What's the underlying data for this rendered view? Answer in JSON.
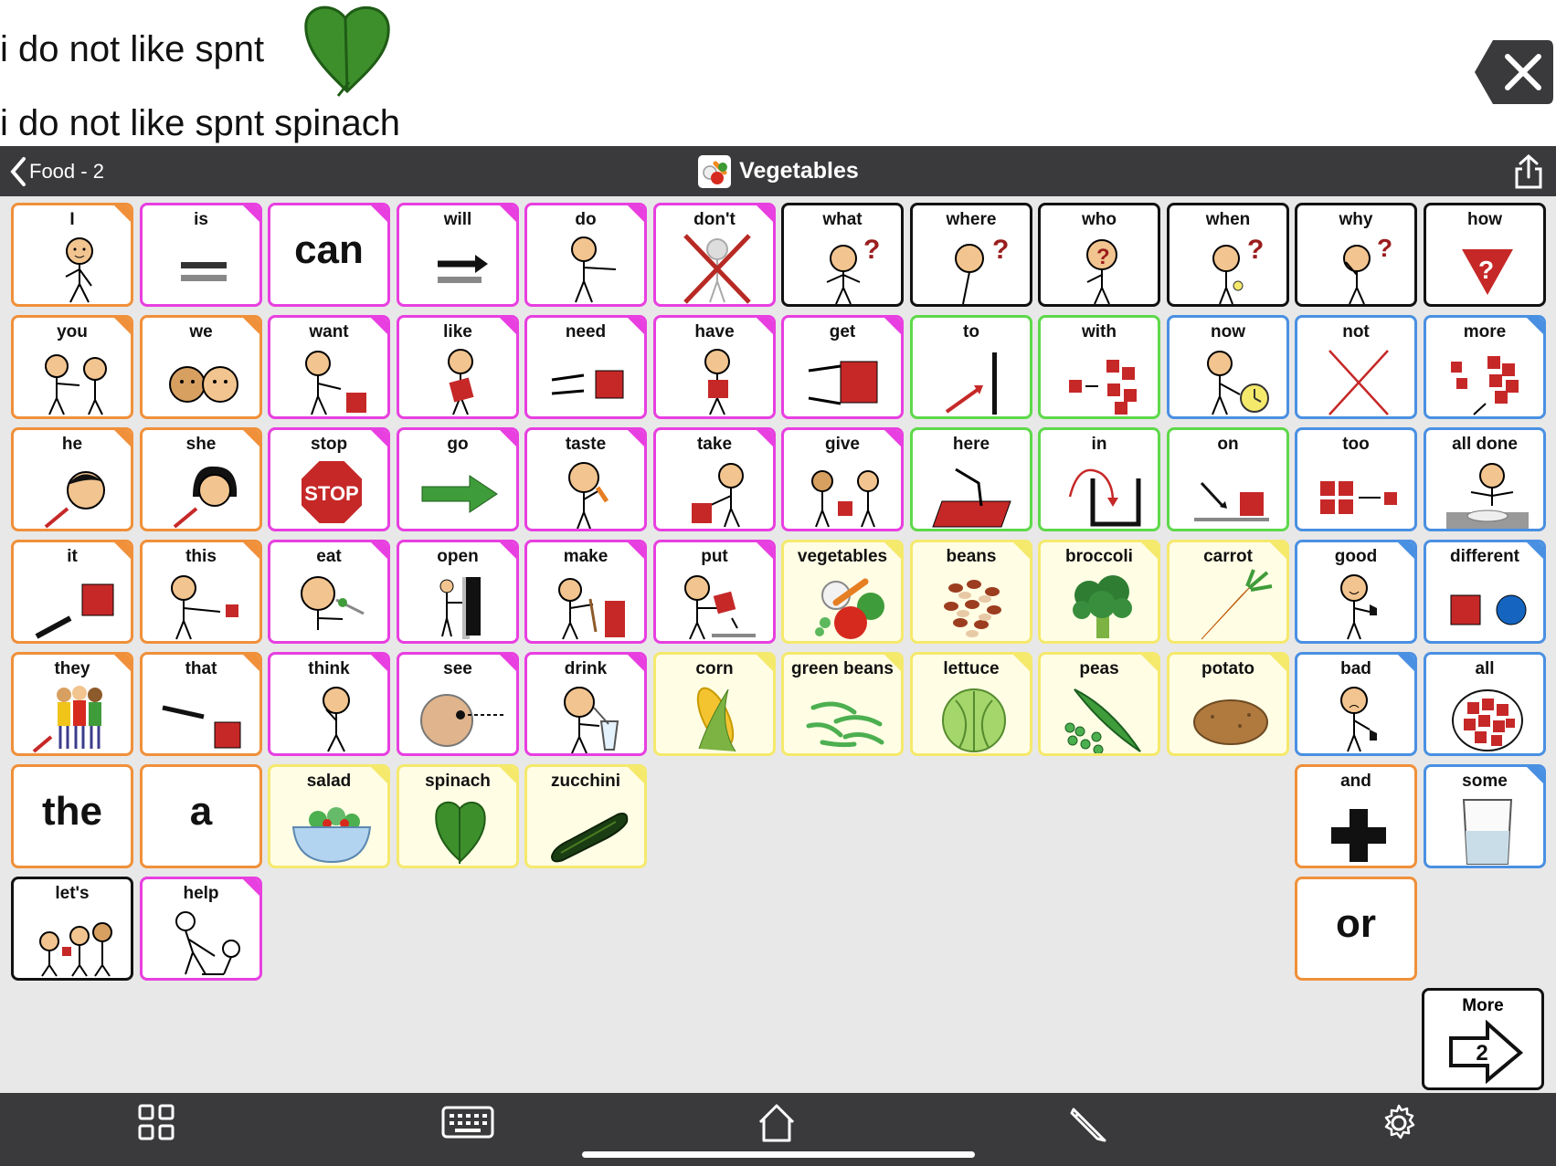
{
  "message": {
    "line1": "i do not like spnt",
    "line2": "i do not like spnt  spinach",
    "icon": "spinach-leaf-icon"
  },
  "header": {
    "back_label": "Food - 2",
    "title": "Vegetables",
    "icons": [
      "back-chevron-icon",
      "vegetables-folder-icon",
      "share-icon"
    ]
  },
  "colors": {
    "orange": "#f0903a",
    "pink": "#e83fe0",
    "black": "#111111",
    "green": "#5ed84a",
    "blue": "#4a90e2",
    "yellow": "#f5e96c",
    "toolbar": "#3a3a3c"
  },
  "cells": [
    {
      "label": "I"
    },
    {
      "label": "is"
    },
    {
      "label": "can"
    },
    {
      "label": "will"
    },
    {
      "label": "do"
    },
    {
      "label": "don't"
    },
    {
      "label": "what"
    },
    {
      "label": "where"
    },
    {
      "label": "who"
    },
    {
      "label": "when"
    },
    {
      "label": "why"
    },
    {
      "label": "how"
    },
    {
      "label": "you"
    },
    {
      "label": "we"
    },
    {
      "label": "want"
    },
    {
      "label": "like"
    },
    {
      "label": "need"
    },
    {
      "label": "have"
    },
    {
      "label": "get"
    },
    {
      "label": "to"
    },
    {
      "label": "with"
    },
    {
      "label": "now"
    },
    {
      "label": "not"
    },
    {
      "label": "more"
    },
    {
      "label": "he"
    },
    {
      "label": "she"
    },
    {
      "label": "stop"
    },
    {
      "label": "go"
    },
    {
      "label": "taste"
    },
    {
      "label": "take"
    },
    {
      "label": "give"
    },
    {
      "label": "here"
    },
    {
      "label": "in"
    },
    {
      "label": "on"
    },
    {
      "label": "too"
    },
    {
      "label": "all done"
    },
    {
      "label": "it"
    },
    {
      "label": "this"
    },
    {
      "label": "eat"
    },
    {
      "label": "open"
    },
    {
      "label": "make"
    },
    {
      "label": "put"
    },
    {
      "label": "vegetables"
    },
    {
      "label": "beans"
    },
    {
      "label": "broccoli"
    },
    {
      "label": "carrot"
    },
    {
      "label": "good"
    },
    {
      "label": "different"
    },
    {
      "label": "they"
    },
    {
      "label": "that"
    },
    {
      "label": "think"
    },
    {
      "label": "see"
    },
    {
      "label": "drink"
    },
    {
      "label": "corn"
    },
    {
      "label": "green beans"
    },
    {
      "label": "lettuce"
    },
    {
      "label": "peas"
    },
    {
      "label": "potato"
    },
    {
      "label": "bad"
    },
    {
      "label": "all"
    },
    {
      "label": "the"
    },
    {
      "label": "a"
    },
    {
      "label": "salad"
    },
    {
      "label": "spinach"
    },
    {
      "label": "zucchini"
    },
    {
      "label": "and"
    },
    {
      "label": "some"
    },
    {
      "label": "let's"
    },
    {
      "label": "help"
    },
    {
      "label": "or"
    }
  ],
  "stop_sign_text": "STOP",
  "more_button": {
    "label": "More",
    "page": "2"
  },
  "toolbar": {
    "icons": [
      "grid-icon",
      "keyboard-icon",
      "home-icon",
      "pencil-icon",
      "gear-icon"
    ]
  }
}
